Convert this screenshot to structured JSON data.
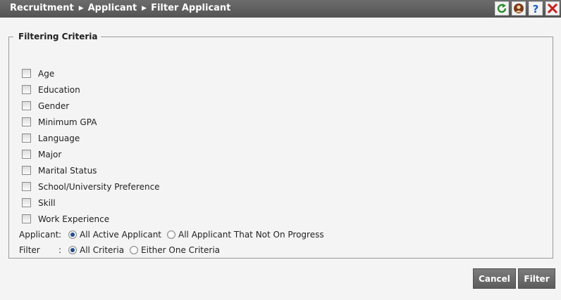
{
  "breadcrumb": [
    "Recruitment",
    "Applicant",
    "Filter Applicant"
  ],
  "breadcrumb_separator": "▶",
  "toolbar_icons": [
    "refresh-icon",
    "person-help-icon",
    "help-icon",
    "close-icon"
  ],
  "fieldset": {
    "legend": "Filtering Criteria",
    "criteria": [
      {
        "label": "Age",
        "checked": false
      },
      {
        "label": "Education",
        "checked": false
      },
      {
        "label": "Gender",
        "checked": false
      },
      {
        "label": "Minimum GPA",
        "checked": false
      },
      {
        "label": "Language",
        "checked": false
      },
      {
        "label": "Major",
        "checked": false
      },
      {
        "label": "Marital Status",
        "checked": false
      },
      {
        "label": "School/University Preference",
        "checked": false
      },
      {
        "label": "Skill",
        "checked": false
      },
      {
        "label": "Work Experience",
        "checked": false
      }
    ],
    "applicant": {
      "label": "Applicant",
      "colon": ":",
      "options": [
        {
          "label": "All Active Applicant",
          "selected": true
        },
        {
          "label": "All Applicant That Not On Progress",
          "selected": false
        }
      ]
    },
    "filter": {
      "label": "Filter",
      "colon": ":",
      "options": [
        {
          "label": "All Criteria",
          "selected": true
        },
        {
          "label": "Either One Criteria",
          "selected": false
        }
      ]
    }
  },
  "buttons": {
    "cancel": "Cancel",
    "filter": "Filter"
  },
  "colors": {
    "titlebar": "#5e5e5e",
    "button": "#6a6a6a",
    "refresh": "#2e8b2e",
    "help": "#1f5fbf",
    "close": "#c81e1e"
  }
}
